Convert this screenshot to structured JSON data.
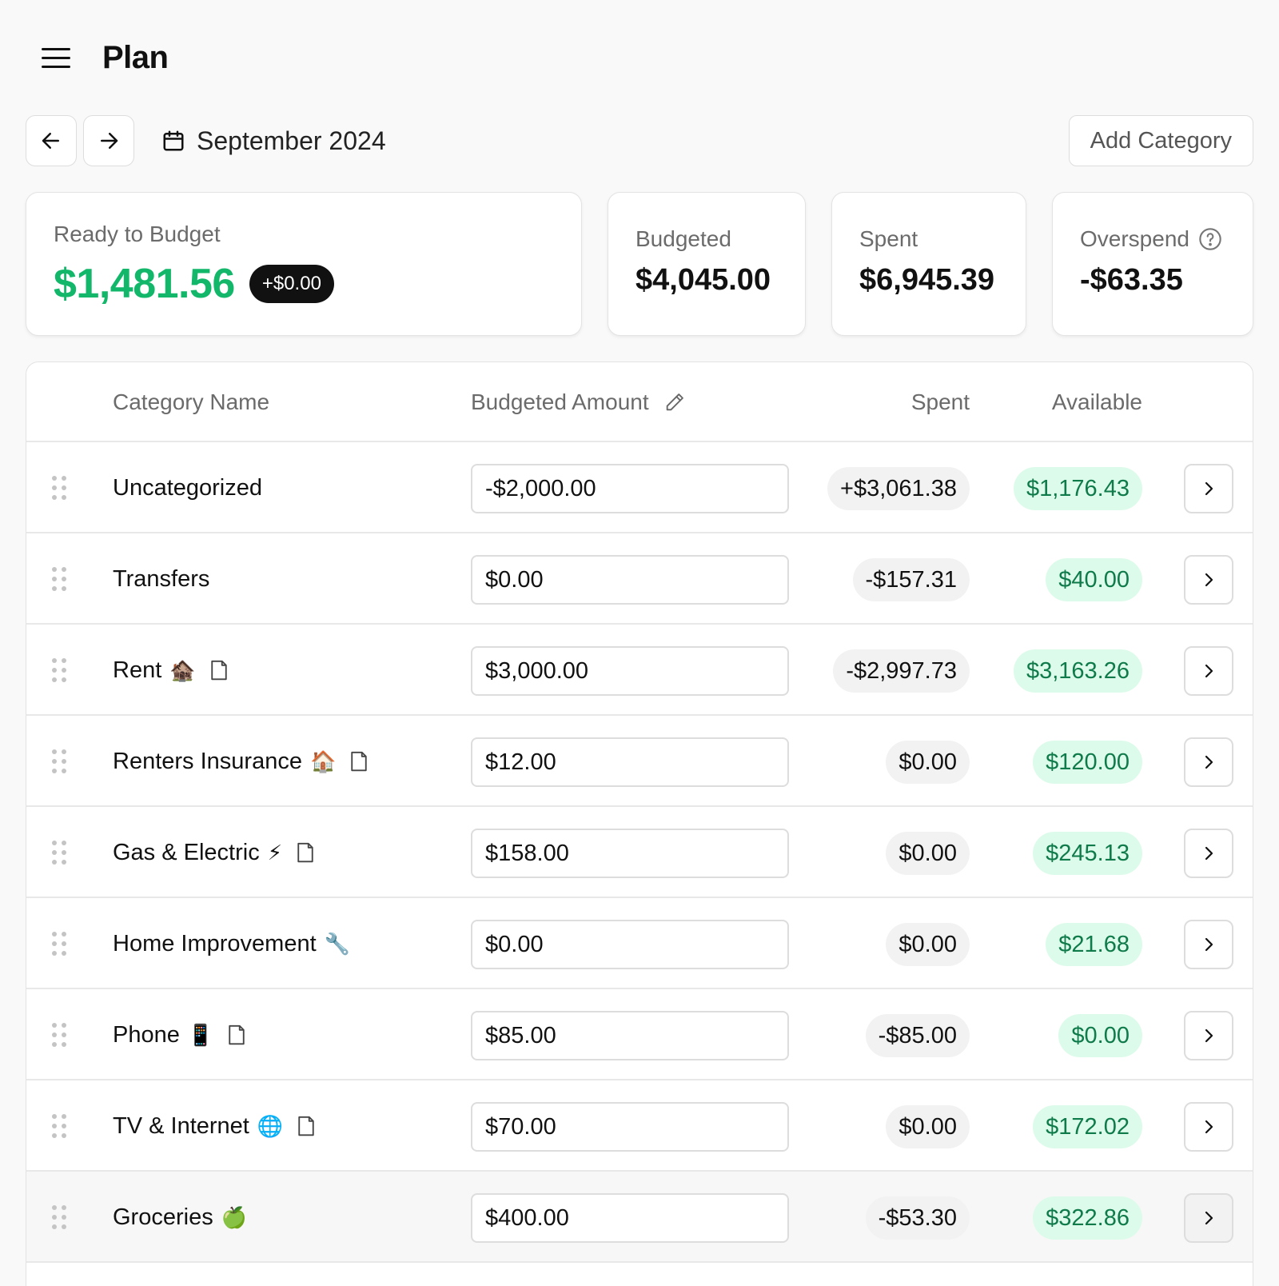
{
  "header": {
    "title": "Plan"
  },
  "toolbar": {
    "month": "September 2024",
    "add_category": "Add Category"
  },
  "summary": {
    "ready": {
      "label": "Ready to Budget",
      "value": "$1,481.56",
      "badge": "+$0.00"
    },
    "budgeted": {
      "label": "Budgeted",
      "value": "$4,045.00"
    },
    "spent": {
      "label": "Spent",
      "value": "$6,945.39"
    },
    "overspend": {
      "label": "Overspend",
      "value": "-$63.35"
    }
  },
  "table": {
    "headers": {
      "name": "Category Name",
      "budgeted": "Budgeted Amount",
      "spent": "Spent",
      "available": "Available"
    },
    "rows": [
      {
        "name": "Uncategorized",
        "emoji": "",
        "note": false,
        "budgeted": "-$2,000.00",
        "spent": "+$3,061.38",
        "available": "$1,176.43"
      },
      {
        "name": "Transfers",
        "emoji": "",
        "note": false,
        "budgeted": "$0.00",
        "spent": "-$157.31",
        "available": "$40.00"
      },
      {
        "name": "Rent",
        "emoji": "🏚️",
        "note": true,
        "budgeted": "$3,000.00",
        "spent": "-$2,997.73",
        "available": "$3,163.26"
      },
      {
        "name": "Renters Insurance",
        "emoji": "🏠",
        "note": true,
        "budgeted": "$12.00",
        "spent": "$0.00",
        "available": "$120.00"
      },
      {
        "name": "Gas & Electric",
        "emoji": "⚡",
        "note": true,
        "budgeted": "$158.00",
        "spent": "$0.00",
        "available": "$245.13"
      },
      {
        "name": "Home Improvement",
        "emoji": "🔧",
        "note": false,
        "budgeted": "$0.00",
        "spent": "$0.00",
        "available": "$21.68"
      },
      {
        "name": "Phone",
        "emoji": "📱",
        "note": true,
        "budgeted": "$85.00",
        "spent": "-$85.00",
        "available": "$0.00"
      },
      {
        "name": "TV & Internet",
        "emoji": "🌐",
        "note": true,
        "budgeted": "$70.00",
        "spent": "$0.00",
        "available": "$172.02"
      },
      {
        "name": "Groceries",
        "emoji": "🍏",
        "note": false,
        "budgeted": "$400.00",
        "spent": "-$53.30",
        "available": "$322.86"
      }
    ]
  },
  "colors": {
    "positive": "#12b76a",
    "available_bg": "#dcfbea",
    "available_text": "#0f7a4a"
  }
}
